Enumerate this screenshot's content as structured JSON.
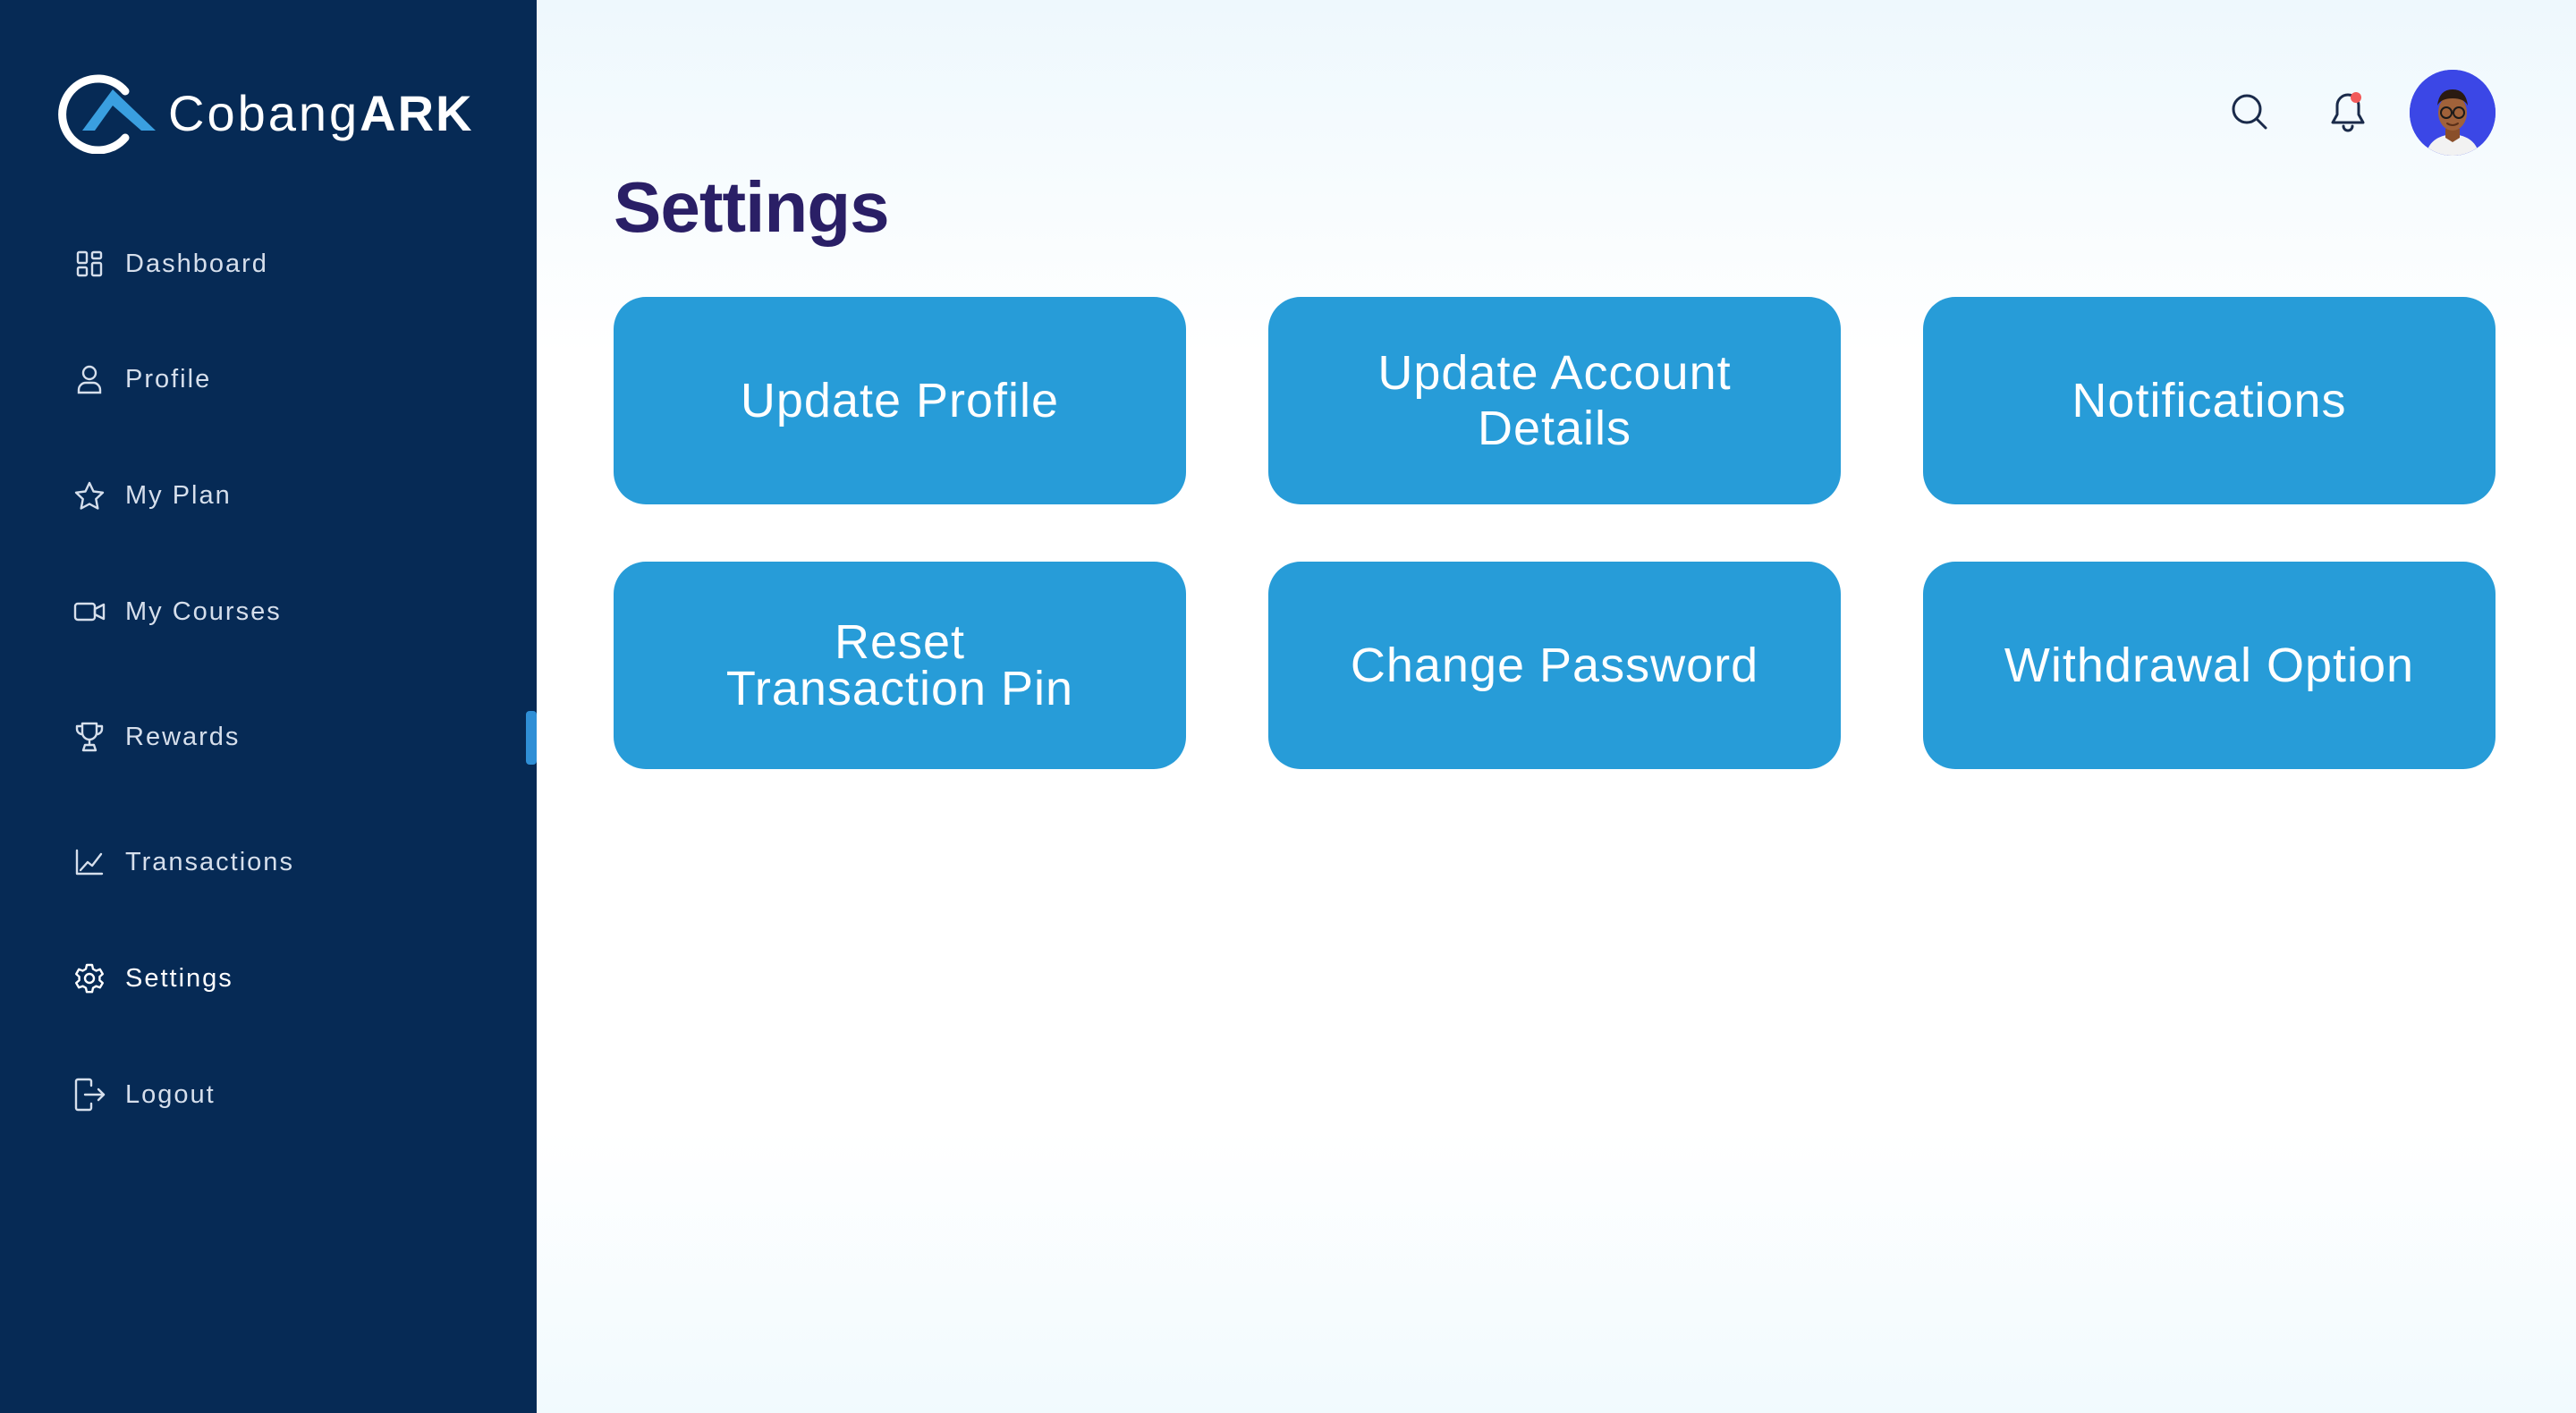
{
  "brand": {
    "name_light": "Cobang",
    "name_bold": "ARK"
  },
  "sidebar": {
    "items": [
      {
        "label": "Dashboard",
        "icon": "dashboard-grid-icon",
        "active": false
      },
      {
        "label": "Profile",
        "icon": "user-icon",
        "active": false
      },
      {
        "label": "My Plan",
        "icon": "star-icon",
        "active": false
      },
      {
        "label": "My Courses",
        "icon": "video-camera-icon",
        "active": false
      },
      {
        "label": "Rewards",
        "icon": "trophy-icon",
        "active": false
      },
      {
        "label": "Transactions",
        "icon": "line-chart-icon",
        "active": false
      },
      {
        "label": "Settings",
        "icon": "gear-icon",
        "active": true
      },
      {
        "label": "Logout",
        "icon": "logout-icon",
        "active": false
      }
    ]
  },
  "header": {
    "search_icon": "search-icon",
    "notification_icon": "bell-icon",
    "has_notification": true,
    "avatar": "user-avatar"
  },
  "main": {
    "title": "Settings",
    "cards": [
      {
        "label": "Update Profile"
      },
      {
        "label": "Update Account\nDetails"
      },
      {
        "label": "Notifications"
      },
      {
        "label": "Reset\nTransaction Pin"
      },
      {
        "label": "Change Password"
      },
      {
        "label": "Withdrawal Option"
      }
    ]
  },
  "colors": {
    "sidebar_bg": "#062a55",
    "card_bg": "#279cd8",
    "title": "#2a1f66",
    "accent": "#2f8fd6",
    "notification_dot": "#f25a5a",
    "avatar_bg": "#3b47e6"
  }
}
